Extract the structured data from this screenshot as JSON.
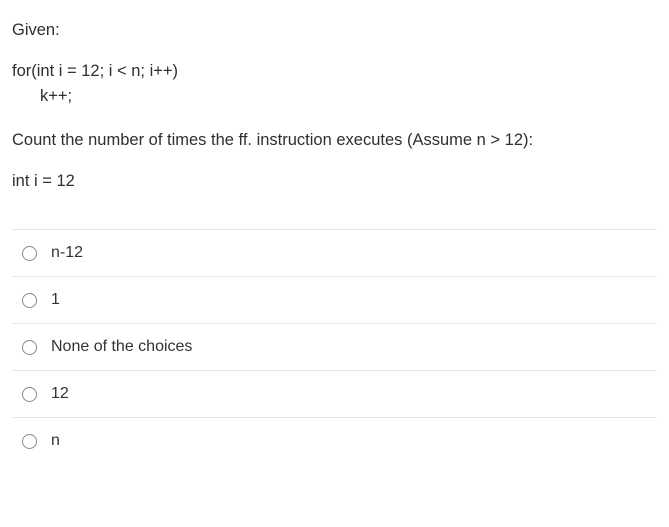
{
  "question": {
    "intro": "Given:",
    "code_line1": "for(int i = 12; i < n; i++)",
    "code_line2": "k++;",
    "ask": "Count the number of times the ff. instruction executes (Assume n > 12):",
    "target": "int i = 12"
  },
  "choices": [
    {
      "label": "n-12"
    },
    {
      "label": "1"
    },
    {
      "label": "None of the choices"
    },
    {
      "label": "12"
    },
    {
      "label": "n"
    }
  ]
}
